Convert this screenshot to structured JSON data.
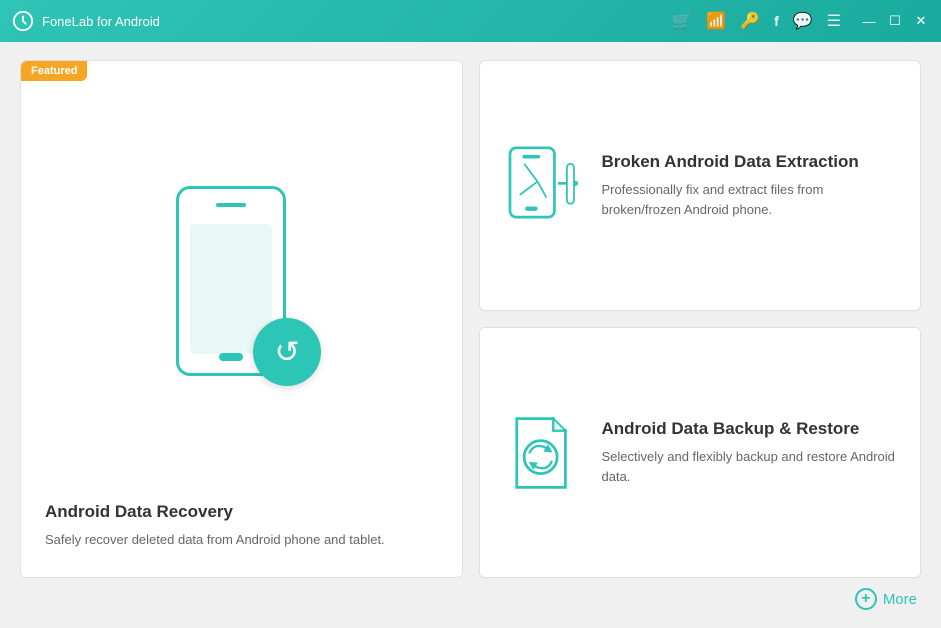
{
  "app": {
    "title": "FoneLab for Android"
  },
  "titlebar": {
    "icons": [
      "cart-icon",
      "wifi-icon",
      "key-icon",
      "facebook-icon",
      "chat-icon",
      "menu-icon"
    ],
    "controls": [
      "minimize-icon",
      "maximize-icon",
      "close-icon"
    ]
  },
  "featured_badge": "Featured",
  "cards": {
    "featured": {
      "title": "Android Data Recovery",
      "description": "Safely recover deleted data from Android phone and tablet."
    },
    "broken": {
      "title": "Broken Android Data Extraction",
      "description": "Professionally fix and extract files from broken/frozen Android phone."
    },
    "backup": {
      "title": "Android Data Backup & Restore",
      "description": "Selectively and flexibly backup and restore Android data."
    }
  },
  "more_button": "More"
}
